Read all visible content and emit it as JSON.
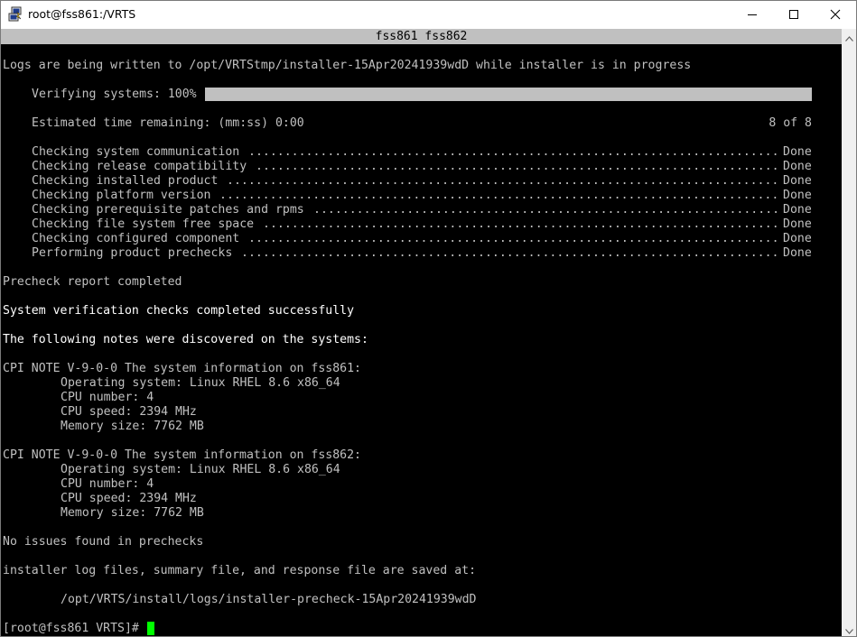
{
  "window": {
    "title": "root@fss861:/VRTS",
    "icon": "putty-icon",
    "controls": {
      "minimize": "minimize-icon",
      "maximize": "maximize-icon",
      "close": "close-icon"
    }
  },
  "terminal": {
    "header": "fss861 fss862",
    "log_line": "Logs are being written to /opt/VRTStmp/installer-15Apr20241939wdD while installer is in progress",
    "verifying": "Verifying systems: 100%",
    "progress_percent": 100,
    "estimated": "Estimated time remaining: (mm:ss) 0:00",
    "step_count": "8 of 8",
    "checks": [
      {
        "label": "Checking system communication",
        "status": "Done"
      },
      {
        "label": "Checking release compatibility",
        "status": "Done"
      },
      {
        "label": "Checking installed product",
        "status": "Done"
      },
      {
        "label": "Checking platform version",
        "status": "Done"
      },
      {
        "label": "Checking prerequisite patches and rpms",
        "status": "Done"
      },
      {
        "label": "Checking file system free space",
        "status": "Done"
      },
      {
        "label": "Checking configured component",
        "status": "Done"
      },
      {
        "label": "Performing product prechecks",
        "status": "Done"
      }
    ],
    "precheck_report": "Precheck report completed",
    "verification_success": "System verification checks completed successfully",
    "notes_heading": "The following notes were discovered on the systems:",
    "notes": [
      {
        "heading": "CPI NOTE V-9-0-0 The system information on fss861:",
        "os": "Operating system: Linux RHEL 8.6 x86_64",
        "cpu_number": "CPU number: 4",
        "cpu_speed": "CPU speed: 2394 MHz",
        "memory": "Memory size: 7762 MB"
      },
      {
        "heading": "CPI NOTE V-9-0-0 The system information on fss862:",
        "os": "Operating system: Linux RHEL 8.6 x86_64",
        "cpu_number": "CPU number: 4",
        "cpu_speed": "CPU speed: 2394 MHz",
        "memory": "Memory size: 7762 MB"
      }
    ],
    "no_issues": "No issues found in prechecks",
    "saved_at": "installer log files, summary file, and response file are saved at:",
    "log_path": "/opt/VRTS/install/logs/installer-precheck-15Apr20241939wdD",
    "prompt": "[root@fss861 VRTS]# "
  },
  "colors": {
    "background": "#000000",
    "text": "#c0c0c0",
    "bright_text": "#ffffff",
    "header_bar": "#c0c0c0",
    "cursor": "#00ff00"
  }
}
